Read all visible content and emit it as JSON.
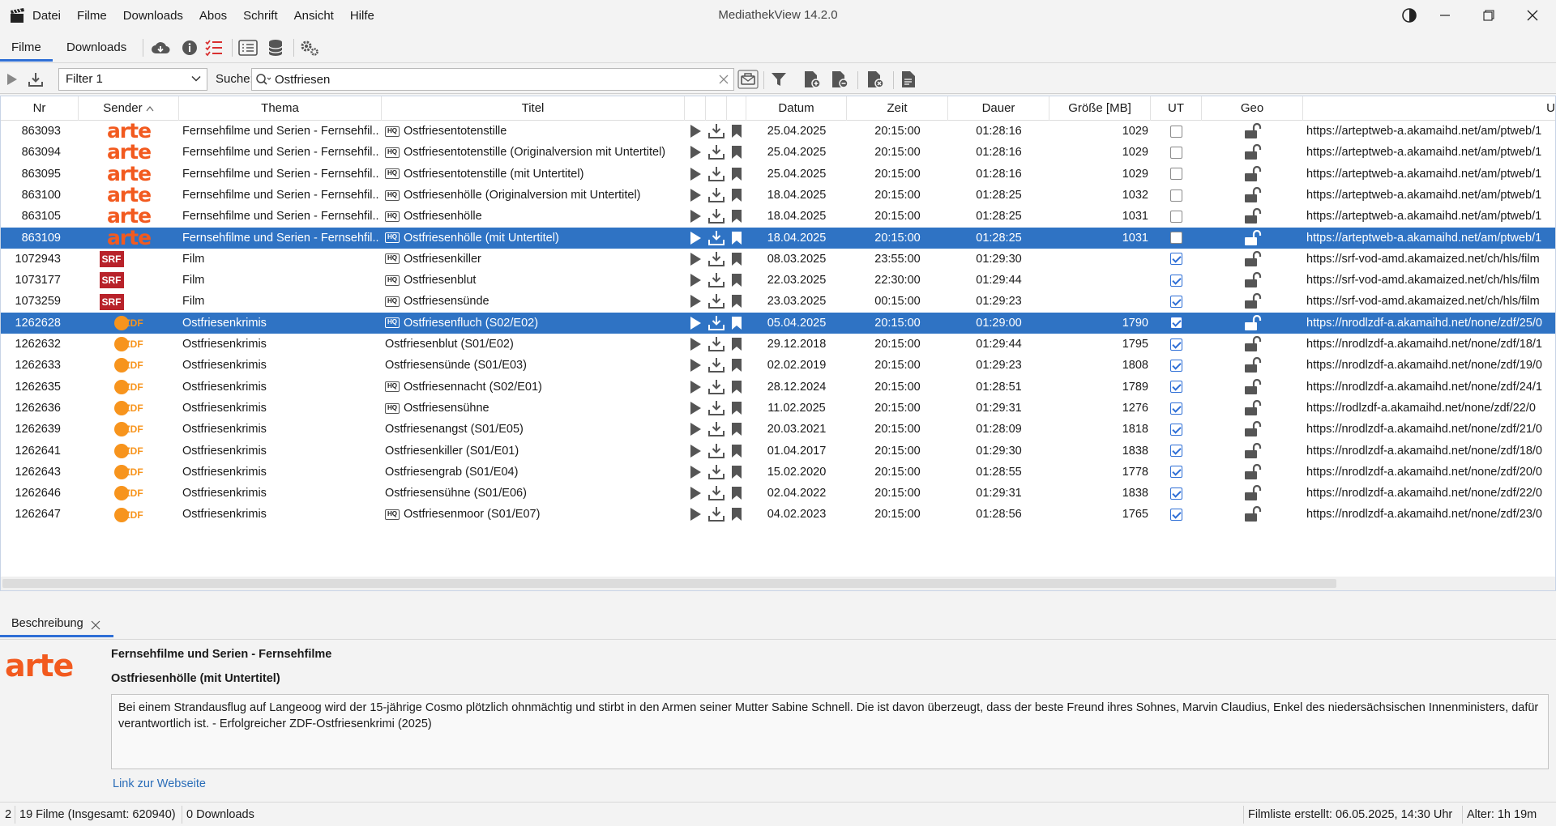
{
  "window": {
    "title": "MediathekView 14.2.0"
  },
  "menu": [
    "Datei",
    "Filme",
    "Downloads",
    "Abos",
    "Schrift",
    "Ansicht",
    "Hilfe"
  ],
  "tabs": {
    "filme": "Filme",
    "downloads": "Downloads"
  },
  "filter": {
    "selected": "Filter 1",
    "search_label": "Suche:",
    "search_value": "Ostfriesen"
  },
  "columns": [
    "Nr",
    "Sender",
    "Thema",
    "Titel",
    "Datum",
    "Zeit",
    "Dauer",
    "Größe [MB]",
    "UT",
    "Geo",
    "U"
  ],
  "rows": [
    {
      "nr": "863093",
      "sender": "arte",
      "thema": "Fernsehfilme und Serien - Fernsehfil...",
      "hq": true,
      "titel": "Ostfriesentotenstille",
      "datum": "25.04.2025",
      "zeit": "20:15:00",
      "dauer": "01:28:16",
      "groesse": "1029",
      "ut": false,
      "url": "https://arteptweb-a.akamaihd.net/am/ptweb/1",
      "selected": false
    },
    {
      "nr": "863094",
      "sender": "arte",
      "thema": "Fernsehfilme und Serien - Fernsehfil...",
      "hq": true,
      "titel": "Ostfriesentotenstille (Originalversion mit Untertitel)",
      "datum": "25.04.2025",
      "zeit": "20:15:00",
      "dauer": "01:28:16",
      "groesse": "1029",
      "ut": false,
      "url": "https://arteptweb-a.akamaihd.net/am/ptweb/1",
      "selected": false
    },
    {
      "nr": "863095",
      "sender": "arte",
      "thema": "Fernsehfilme und Serien - Fernsehfil...",
      "hq": true,
      "titel": "Ostfriesentotenstille (mit Untertitel)",
      "datum": "25.04.2025",
      "zeit": "20:15:00",
      "dauer": "01:28:16",
      "groesse": "1029",
      "ut": false,
      "url": "https://arteptweb-a.akamaihd.net/am/ptweb/1",
      "selected": false
    },
    {
      "nr": "863100",
      "sender": "arte",
      "thema": "Fernsehfilme und Serien - Fernsehfil...",
      "hq": true,
      "titel": "Ostfriesenhölle (Originalversion mit Untertitel)",
      "datum": "18.04.2025",
      "zeit": "20:15:00",
      "dauer": "01:28:25",
      "groesse": "1032",
      "ut": false,
      "url": "https://arteptweb-a.akamaihd.net/am/ptweb/1",
      "selected": false
    },
    {
      "nr": "863105",
      "sender": "arte",
      "thema": "Fernsehfilme und Serien - Fernsehfil...",
      "hq": true,
      "titel": "Ostfriesenhölle",
      "datum": "18.04.2025",
      "zeit": "20:15:00",
      "dauer": "01:28:25",
      "groesse": "1031",
      "ut": false,
      "url": "https://arteptweb-a.akamaihd.net/am/ptweb/1",
      "selected": false
    },
    {
      "nr": "863109",
      "sender": "arte",
      "thema": "Fernsehfilme und Serien - Fernsehfil...",
      "hq": true,
      "titel": "Ostfriesenhölle (mit Untertitel)",
      "datum": "18.04.2025",
      "zeit": "20:15:00",
      "dauer": "01:28:25",
      "groesse": "1031",
      "ut": false,
      "url": "https://arteptweb-a.akamaihd.net/am/ptweb/1",
      "selected": true
    },
    {
      "nr": "1072943",
      "sender": "srf",
      "thema": "Film",
      "hq": true,
      "titel": "Ostfriesenkiller",
      "datum": "08.03.2025",
      "zeit": "23:55:00",
      "dauer": "01:29:30",
      "groesse": "",
      "ut": true,
      "url": "https://srf-vod-amd.akamaized.net/ch/hls/film",
      "selected": false
    },
    {
      "nr": "1073177",
      "sender": "srf",
      "thema": "Film",
      "hq": true,
      "titel": "Ostfriesenblut",
      "datum": "22.03.2025",
      "zeit": "22:30:00",
      "dauer": "01:29:44",
      "groesse": "",
      "ut": true,
      "url": "https://srf-vod-amd.akamaized.net/ch/hls/film",
      "selected": false
    },
    {
      "nr": "1073259",
      "sender": "srf",
      "thema": "Film",
      "hq": true,
      "titel": "Ostfriesensünde",
      "datum": "23.03.2025",
      "zeit": "00:15:00",
      "dauer": "01:29:23",
      "groesse": "",
      "ut": true,
      "url": "https://srf-vod-amd.akamaized.net/ch/hls/film",
      "selected": false
    },
    {
      "nr": "1262628",
      "sender": "zdf",
      "thema": "Ostfriesenkrimis",
      "hq": true,
      "titel": "Ostfriesenfluch (S02/E02)",
      "datum": "05.04.2025",
      "zeit": "20:15:00",
      "dauer": "01:29:00",
      "groesse": "1790",
      "ut": true,
      "url": "https://nrodlzdf-a.akamaihd.net/none/zdf/25/0",
      "selected": true
    },
    {
      "nr": "1262632",
      "sender": "zdf",
      "thema": "Ostfriesenkrimis",
      "hq": false,
      "titel": "Ostfriesenblut (S01/E02)",
      "datum": "29.12.2018",
      "zeit": "20:15:00",
      "dauer": "01:29:44",
      "groesse": "1795",
      "ut": true,
      "url": "https://nrodlzdf-a.akamaihd.net/none/zdf/18/1",
      "selected": false
    },
    {
      "nr": "1262633",
      "sender": "zdf",
      "thema": "Ostfriesenkrimis",
      "hq": false,
      "titel": "Ostfriesensünde (S01/E03)",
      "datum": "02.02.2019",
      "zeit": "20:15:00",
      "dauer": "01:29:23",
      "groesse": "1808",
      "ut": true,
      "url": "https://nrodlzdf-a.akamaihd.net/none/zdf/19/0",
      "selected": false
    },
    {
      "nr": "1262635",
      "sender": "zdf",
      "thema": "Ostfriesenkrimis",
      "hq": true,
      "titel": "Ostfriesennacht (S02/E01)",
      "datum": "28.12.2024",
      "zeit": "20:15:00",
      "dauer": "01:28:51",
      "groesse": "1789",
      "ut": true,
      "url": "https://nrodlzdf-a.akamaihd.net/none/zdf/24/1",
      "selected": false
    },
    {
      "nr": "1262636",
      "sender": "zdf",
      "thema": "Ostfriesenkrimis",
      "hq": true,
      "titel": "Ostfriesensühne",
      "datum": "11.02.2025",
      "zeit": "20:15:00",
      "dauer": "01:29:31",
      "groesse": "1276",
      "ut": true,
      "url": "https://rodlzdf-a.akamaihd.net/none/zdf/22/0",
      "selected": false
    },
    {
      "nr": "1262639",
      "sender": "zdf",
      "thema": "Ostfriesenkrimis",
      "hq": false,
      "titel": "Ostfriesenangst (S01/E05)",
      "datum": "20.03.2021",
      "zeit": "20:15:00",
      "dauer": "01:28:09",
      "groesse": "1818",
      "ut": true,
      "url": "https://nrodlzdf-a.akamaihd.net/none/zdf/21/0",
      "selected": false
    },
    {
      "nr": "1262641",
      "sender": "zdf",
      "thema": "Ostfriesenkrimis",
      "hq": false,
      "titel": "Ostfriesenkiller (S01/E01)",
      "datum": "01.04.2017",
      "zeit": "20:15:00",
      "dauer": "01:29:30",
      "groesse": "1838",
      "ut": true,
      "url": "https://nrodlzdf-a.akamaihd.net/none/zdf/18/0",
      "selected": false
    },
    {
      "nr": "1262643",
      "sender": "zdf",
      "thema": "Ostfriesenkrimis",
      "hq": false,
      "titel": "Ostfriesengrab (S01/E04)",
      "datum": "15.02.2020",
      "zeit": "20:15:00",
      "dauer": "01:28:55",
      "groesse": "1778",
      "ut": true,
      "url": "https://nrodlzdf-a.akamaihd.net/none/zdf/20/0",
      "selected": false
    },
    {
      "nr": "1262646",
      "sender": "zdf",
      "thema": "Ostfriesenkrimis",
      "hq": false,
      "titel": "Ostfriesensühne (S01/E06)",
      "datum": "02.04.2022",
      "zeit": "20:15:00",
      "dauer": "01:29:31",
      "groesse": "1838",
      "ut": true,
      "url": "https://nrodlzdf-a.akamaihd.net/none/zdf/22/0",
      "selected": false
    },
    {
      "nr": "1262647",
      "sender": "zdf",
      "thema": "Ostfriesenkrimis",
      "hq": true,
      "titel": "Ostfriesenmoor (S01/E07)",
      "datum": "04.02.2023",
      "zeit": "20:15:00",
      "dauer": "01:28:56",
      "groesse": "1765",
      "ut": true,
      "url": "https://nrodlzdf-a.akamaihd.net/none/zdf/23/0",
      "selected": false
    }
  ],
  "description": {
    "tab_label": "Beschreibung",
    "logo_text": "arte",
    "thema": "Fernsehfilme und Serien - Fernsehfilme",
    "titel": "Ostfriesenhölle (mit Untertitel)",
    "text": "Bei einem Strandausflug auf Langeoog wird der 15-jährige Cosmo plötzlich ohnmächtig und stirbt in den Armen seiner Mutter Sabine Schnell. Die ist davon überzeugt, dass der beste Freund ihres Sohnes, Marvin Claudius, Enkel des niedersächsischen Innenministers, dafür verantwortlich ist. - Erfolgreicher ZDF-Ostfriesenkrimi (2025)",
    "link": "Link zur Webseite"
  },
  "status": {
    "selected_count": "2",
    "films": "19 Filme (Insgesamt: 620940)",
    "downloads": "0 Downloads",
    "list_created": "Filmliste erstellt: 06.05.2025, 14:30 Uhr",
    "age": "Alter: 1h 19m"
  },
  "colors": {
    "selection": "#2f73c4",
    "accent": "#2f6fd6",
    "arte": "#f25a1f",
    "zdf": "#f7941d",
    "srf": "#b8222a"
  }
}
